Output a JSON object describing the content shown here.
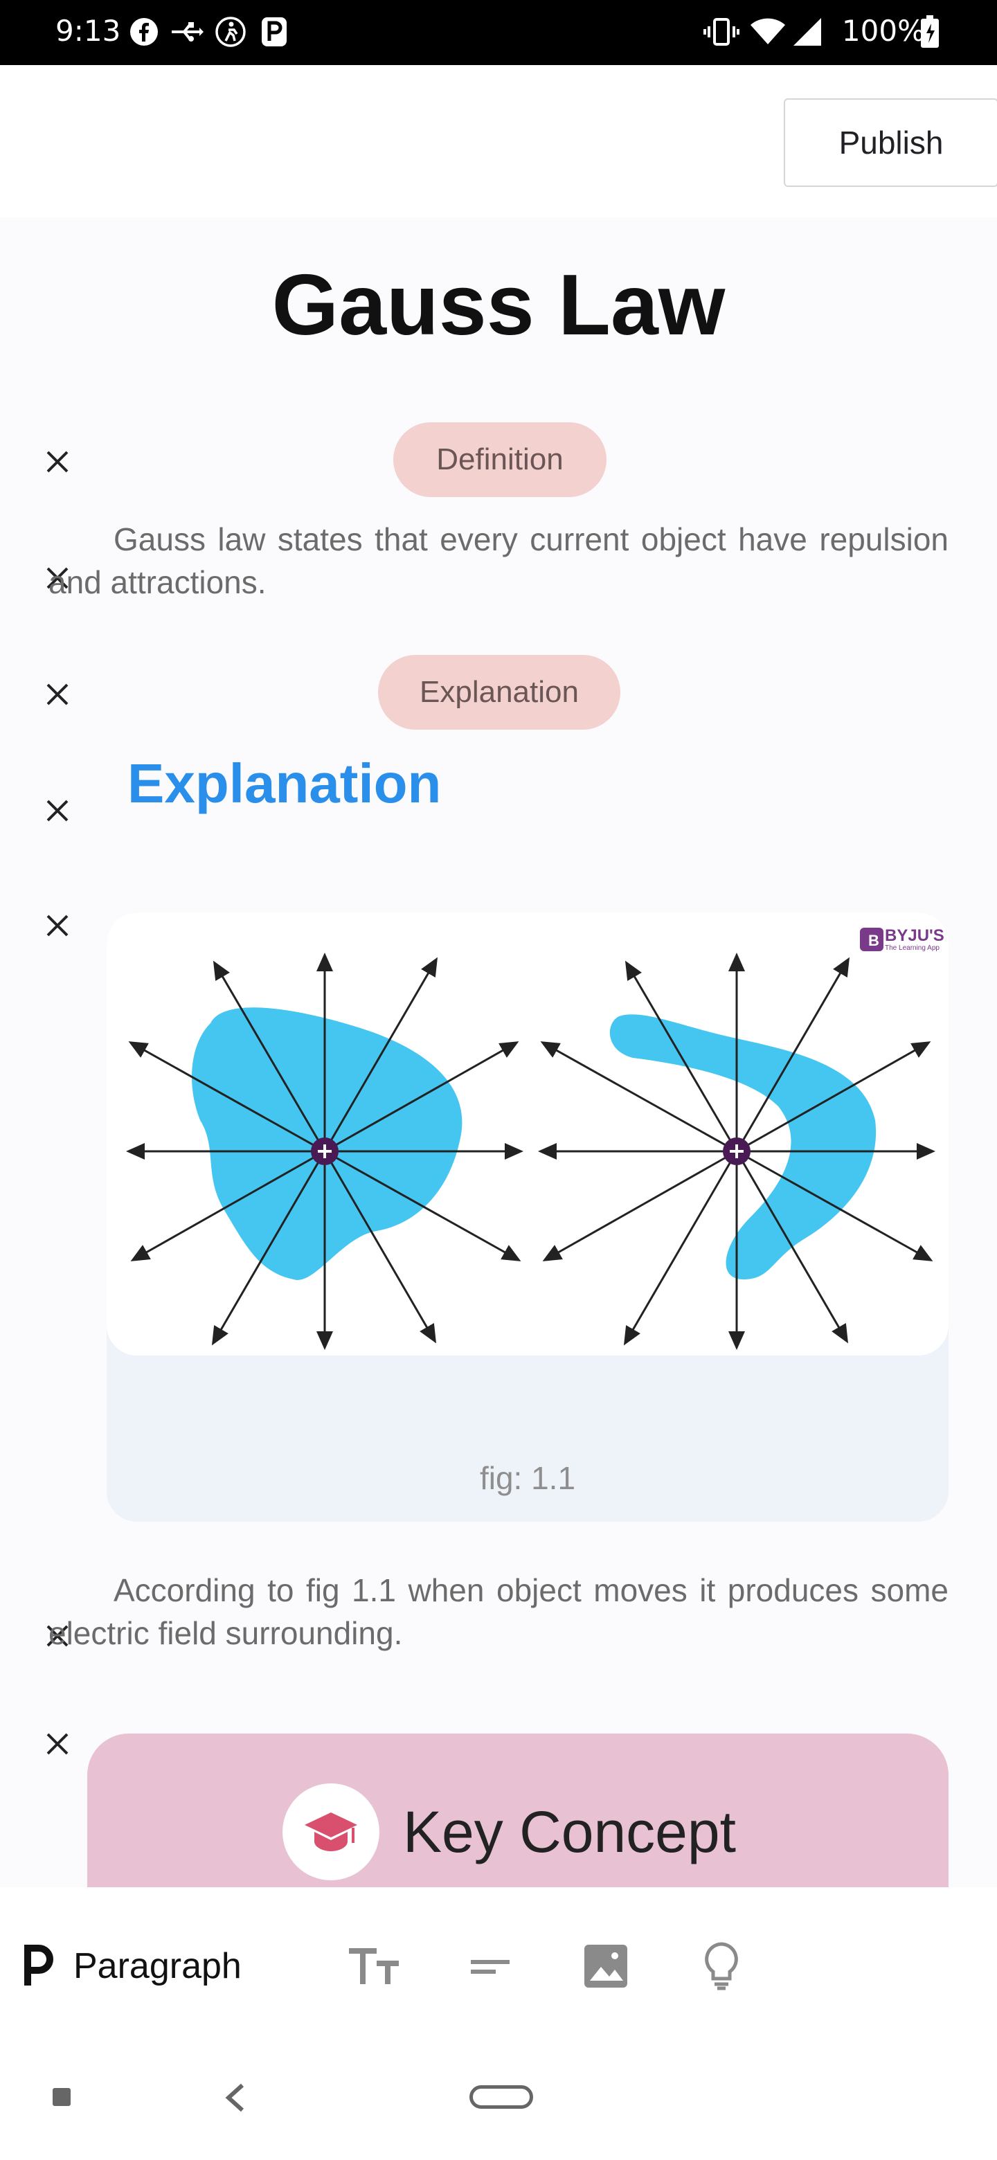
{
  "status_bar": {
    "time": "9:13",
    "battery": "100%",
    "icons": [
      "facebook-icon",
      "usb-icon",
      "accessibility-icon",
      "p-app-icon",
      "vibrate-icon",
      "wifi-icon",
      "signal-icon",
      "battery-icon"
    ]
  },
  "header": {
    "publish_label": "Publish"
  },
  "document": {
    "title": "Gauss Law",
    "definition_pill": "Definition",
    "definition_text": "Gauss law states that every current object have repulsion and attractions.",
    "explanation_pill": "Explanation",
    "explanation_heading": "Explanation",
    "figure": {
      "logo_text": "BYJU'S",
      "logo_subtext": "The Learning App",
      "caption": "fig: 1.1"
    },
    "explanation_text": "According to fig 1.1 when object moves it produces some electric field surrounding.",
    "key_concept_label": "Key Concept"
  },
  "toolbar": {
    "paragraph_label": "Paragraph",
    "tools": [
      "paragraph-icon",
      "text-size-icon",
      "align-icon",
      "image-icon",
      "lightbulb-icon"
    ]
  },
  "colors": {
    "accent_blue": "#2a8fea",
    "pill_bg": "#f3d1cf",
    "key_concept_bg": "#e8c2d2",
    "key_concept_icon": "#d9506e",
    "blob": "#45c6f0"
  }
}
